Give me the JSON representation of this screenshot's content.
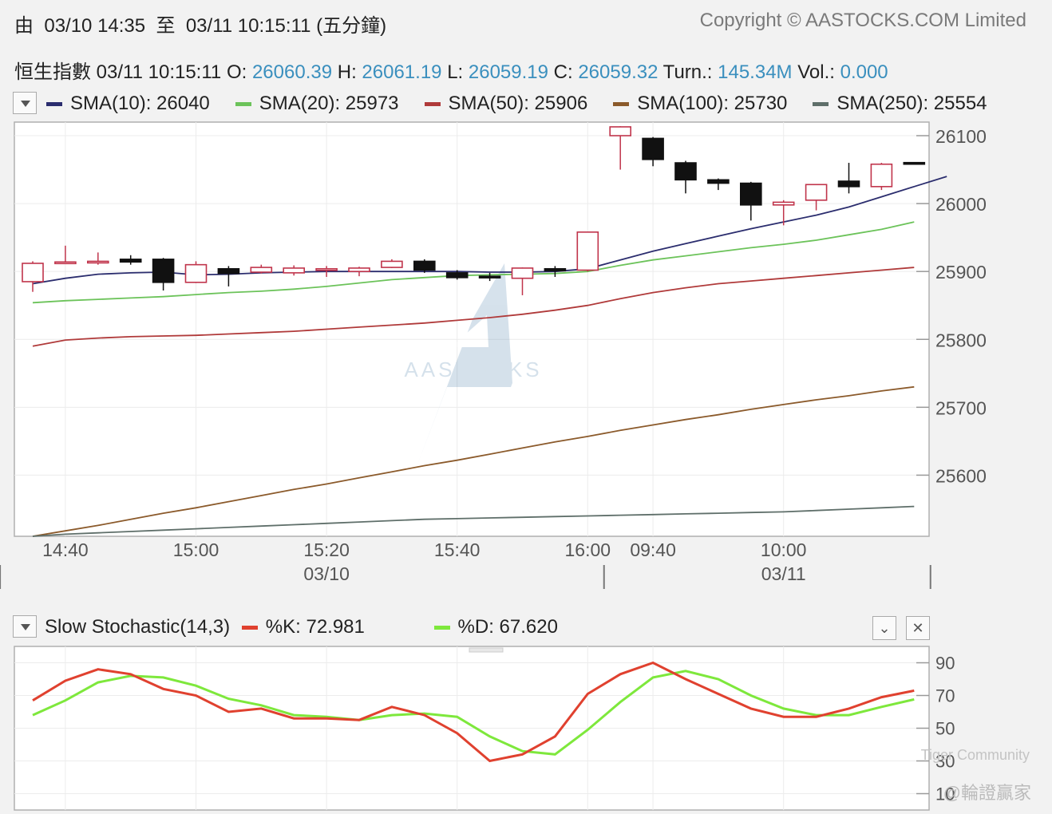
{
  "header": {
    "range_prefix": "由",
    "range_from": "03/10 14:35",
    "range_to_word": "至",
    "range_to": "03/11 10:15:11",
    "interval": "(五分鐘)",
    "copyright": "Copyright © AASTOCKS.COM Limited"
  },
  "quote": {
    "name": "恒生指數",
    "time": "03/11 10:15:11",
    "o_label": "O:",
    "o": "26060.39",
    "h_label": "H:",
    "h": "26061.19",
    "l_label": "L:",
    "l": "26059.19",
    "c_label": "C:",
    "c": "26059.32",
    "turn_label": "Turn.:",
    "turn": "145.34M",
    "vol_label": "Vol.:",
    "vol": "0.000"
  },
  "sma_legend": [
    {
      "label": "SMA(10): 26040",
      "color": "#2b2d6e"
    },
    {
      "label": "SMA(20): 25973",
      "color": "#6cc35a"
    },
    {
      "label": "SMA(50): 25906",
      "color": "#b03a3a"
    },
    {
      "label": "SMA(100): 25730",
      "color": "#8b5a2b"
    },
    {
      "label": "SMA(250): 25554",
      "color": "#5f6f6a"
    }
  ],
  "stoch_legend": {
    "title": "Slow Stochastic(14,3)",
    "k_label": "%K: 72.981",
    "k_color": "#e0412f",
    "d_label": "%D: 67.620",
    "d_color": "#7ee83c"
  },
  "watermark": {
    "brand": "AASTOCKS",
    "community": "Tiger Community",
    "handle": "@輪證贏家"
  },
  "chart_data": [
    {
      "type": "candlestick",
      "ylim": [
        25510,
        26120
      ],
      "yticks": [
        25600,
        25700,
        25800,
        25900,
        26000,
        26100
      ],
      "grid": true,
      "legend_placement": "top",
      "x_tick_labels": [
        "14:40",
        "15:00",
        "15:20",
        "15:40",
        "16:00",
        "09:40",
        "10:00"
      ],
      "x_tick_index": [
        1,
        5,
        9,
        13,
        17,
        19,
        23
      ],
      "date_labels": [
        {
          "label": "03/10",
          "index": 9
        },
        {
          "label": "03/11",
          "index": 23
        }
      ],
      "session_separators": [
        -1,
        17.5,
        27.5
      ],
      "candles": [
        {
          "o": 25885,
          "h": 25915,
          "l": 25870,
          "c": 25912
        },
        {
          "o": 25913,
          "h": 25938,
          "l": 25912,
          "c": 25914
        },
        {
          "o": 25913,
          "h": 25928,
          "l": 25910,
          "c": 25915
        },
        {
          "o": 25918,
          "h": 25924,
          "l": 25910,
          "c": 25914
        },
        {
          "o": 25918,
          "h": 25920,
          "l": 25872,
          "c": 25884
        },
        {
          "o": 25884,
          "h": 25915,
          "l": 25883,
          "c": 25910
        },
        {
          "o": 25904,
          "h": 25908,
          "l": 25878,
          "c": 25897
        },
        {
          "o": 25899,
          "h": 25910,
          "l": 25897,
          "c": 25906
        },
        {
          "o": 25898,
          "h": 25909,
          "l": 25894,
          "c": 25905
        },
        {
          "o": 25902,
          "h": 25908,
          "l": 25892,
          "c": 25904
        },
        {
          "o": 25900,
          "h": 25907,
          "l": 25893,
          "c": 25905
        },
        {
          "o": 25906,
          "h": 25918,
          "l": 25905,
          "c": 25915
        },
        {
          "o": 25915,
          "h": 25918,
          "l": 25898,
          "c": 25902
        },
        {
          "o": 25898,
          "h": 25902,
          "l": 25888,
          "c": 25891
        },
        {
          "o": 25893,
          "h": 25898,
          "l": 25886,
          "c": 25891
        },
        {
          "o": 25890,
          "h": 25906,
          "l": 25865,
          "c": 25905
        },
        {
          "o": 25904,
          "h": 25908,
          "l": 25892,
          "c": 25901
        },
        {
          "o": 25902,
          "h": 25958,
          "l": 25900,
          "c": 25958
        },
        {
          "o": 26100,
          "h": 26114,
          "l": 26050,
          "c": 26113
        },
        {
          "o": 26096,
          "h": 26098,
          "l": 26055,
          "c": 26065
        },
        {
          "o": 26060,
          "h": 26063,
          "l": 26015,
          "c": 26035
        },
        {
          "o": 26035,
          "h": 26037,
          "l": 26020,
          "c": 26030
        },
        {
          "o": 26030,
          "h": 26032,
          "l": 25975,
          "c": 25998
        },
        {
          "o": 25998,
          "h": 26005,
          "l": 25968,
          "c": 26002
        },
        {
          "o": 26005,
          "h": 26028,
          "l": 25990,
          "c": 26028
        },
        {
          "o": 26033,
          "h": 26060,
          "l": 26015,
          "c": 26025
        },
        {
          "o": 26025,
          "h": 26060,
          "l": 26020,
          "c": 26058
        },
        {
          "o": 26060.39,
          "h": 26061.19,
          "l": 26059.19,
          "c": 26059.32
        }
      ],
      "series": [
        {
          "name": "SMA(10)",
          "color": "#2b2d6e",
          "values": [
            25882,
            25890,
            25896,
            25898,
            25899,
            25895,
            25896,
            25898,
            25899,
            25900,
            25900,
            25900,
            25900,
            25900,
            25899,
            25899,
            25900,
            25904,
            25917,
            25930,
            25941,
            25952,
            25963,
            25973,
            25983,
            25995,
            26010,
            26025,
            26040
          ]
        },
        {
          "name": "SMA(20)",
          "color": "#6cc35a",
          "values": [
            25854,
            25857,
            25859,
            25861,
            25863,
            25866,
            25869,
            25871,
            25874,
            25878,
            25883,
            25888,
            25891,
            25894,
            25895,
            25896,
            25897,
            25900,
            25909,
            25917,
            25923,
            25929,
            25935,
            25940,
            25946,
            25954,
            25962,
            25973
          ]
        },
        {
          "name": "SMA(50)",
          "color": "#b03a3a",
          "values": [
            25790,
            25799,
            25802,
            25804,
            25805,
            25806,
            25808,
            25810,
            25812,
            25815,
            25818,
            25821,
            25824,
            25828,
            25832,
            25837,
            25843,
            25850,
            25860,
            25869,
            25876,
            25882,
            25886,
            25890,
            25894,
            25898,
            25902,
            25906
          ]
        },
        {
          "name": "SMA(100)",
          "color": "#8b5a2b",
          "values": [
            25510,
            25518,
            25526,
            25535,
            25544,
            25552,
            25561,
            25570,
            25579,
            25587,
            25596,
            25605,
            25614,
            25622,
            25631,
            25640,
            25649,
            25657,
            25666,
            25674,
            25682,
            25689,
            25697,
            25704,
            25711,
            25717,
            25724,
            25730
          ]
        },
        {
          "name": "SMA(250)",
          "color": "#5f6f6a",
          "values": [
            25510,
            25513,
            25515,
            25517,
            25519,
            25521,
            25523,
            25525,
            25527,
            25529,
            25531,
            25533,
            25535,
            25536,
            25537,
            25538,
            25539,
            25540,
            25541,
            25542,
            25543,
            25544,
            25545,
            25546,
            25548,
            25550,
            25552,
            25554
          ]
        }
      ]
    },
    {
      "type": "line",
      "title": "Slow Stochastic(14,3)",
      "ylim": [
        0,
        100
      ],
      "yticks": [
        10,
        30,
        50,
        70,
        90
      ],
      "grid": true,
      "series": [
        {
          "name": "%K",
          "color": "#e0412f",
          "values": [
            67,
            79,
            86,
            83,
            74,
            70,
            60,
            62,
            56,
            56,
            55,
            63,
            58,
            47,
            30,
            34,
            45,
            71,
            83,
            90,
            80,
            71,
            62,
            57,
            57,
            62,
            69,
            72.981
          ]
        },
        {
          "name": "%D",
          "color": "#7ee83c",
          "values": [
            58,
            67,
            78,
            82,
            81,
            76,
            68,
            64,
            58,
            57,
            55,
            58,
            59,
            57,
            45,
            36,
            34,
            49,
            66,
            81,
            85,
            80,
            70,
            62,
            58,
            58,
            63,
            67.62
          ]
        }
      ]
    }
  ]
}
